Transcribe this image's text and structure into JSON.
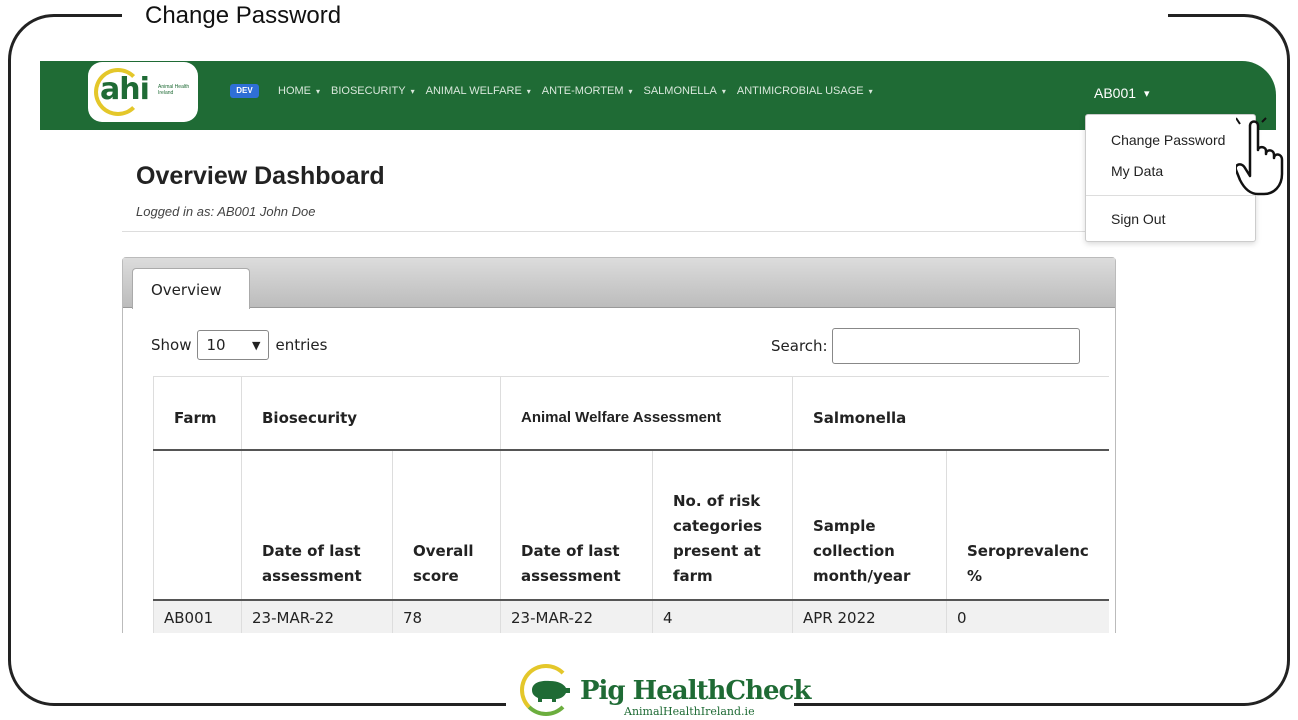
{
  "frame_title": "Change Password",
  "navbar": {
    "logo_text": "ahi",
    "logo_small": "Animal Health Ireland",
    "env_badge": "DEV",
    "items": [
      {
        "label": "HOME"
      },
      {
        "label": "BIOSECURITY"
      },
      {
        "label": "ANIMAL WELFARE"
      },
      {
        "label": "ANTE-MORTEM"
      },
      {
        "label": "SALMONELLA"
      },
      {
        "label": "ANTIMICROBIAL USAGE"
      }
    ],
    "user": "AB001",
    "caret": "▾",
    "bg_color": "#1f6b35"
  },
  "dropdown": {
    "items": [
      "Change Password",
      "My Data",
      "Sign Out"
    ]
  },
  "page": {
    "title": "Overview Dashboard",
    "logged_in": "Logged in as: AB001 John Doe"
  },
  "panel": {
    "tab": "Overview",
    "show_label": "Show",
    "entries_value": "10",
    "entries_label": "entries",
    "search_label": "Search:",
    "search_value": ""
  },
  "table": {
    "group_headers": [
      "Farm",
      "Biosecurity",
      "Animal Welfare Assessment",
      "Salmonella"
    ],
    "sub_headers": [
      "",
      "Date of last assessment",
      "Overall score",
      "Date of last assessment",
      "No. of risk categories present at farm",
      "Sample collection month/year",
      "Seroprevalenc %"
    ],
    "rows": [
      [
        "AB001",
        "23-MAR-22",
        "78",
        "23-MAR-22",
        "4",
        "APR 2022",
        "0"
      ]
    ]
  },
  "footer_logo": {
    "title": "Pig HealthCheck",
    "subtitle": "AnimalHealthIreland.ie"
  }
}
